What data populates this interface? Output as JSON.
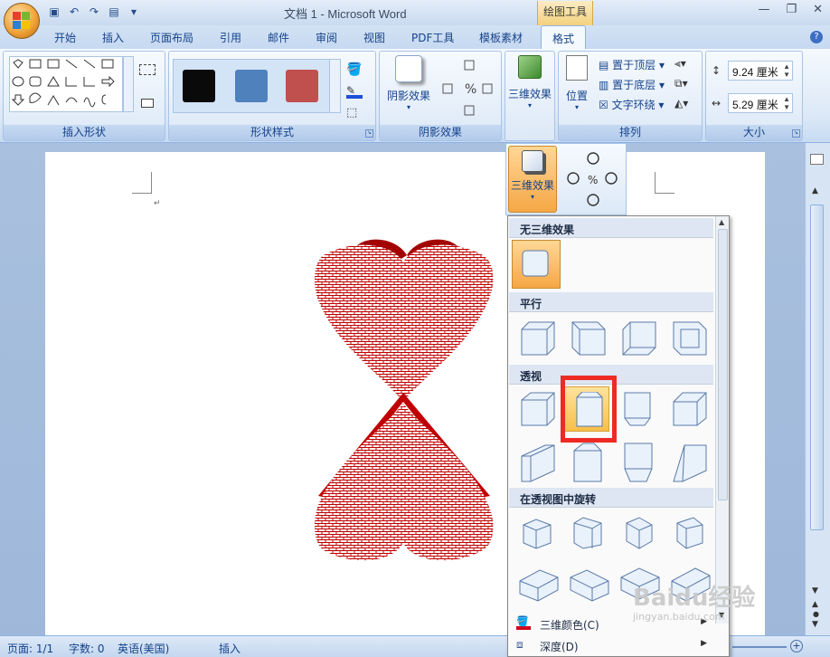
{
  "window": {
    "title": "文档 1 - Microsoft Word",
    "context_tab_header": "绘图工具"
  },
  "tabs": [
    {
      "label": "开始"
    },
    {
      "label": "插入"
    },
    {
      "label": "页面布局"
    },
    {
      "label": "引用"
    },
    {
      "label": "邮件"
    },
    {
      "label": "审阅"
    },
    {
      "label": "视图"
    },
    {
      "label": "PDF工具"
    },
    {
      "label": "模板素材"
    },
    {
      "label": "格式"
    }
  ],
  "active_tab": "格式",
  "ribbon": {
    "groups": {
      "insert_shapes": "插入形状",
      "shape_styles": "形状样式",
      "shadow_effects": "阴影效果",
      "effects_3d": "三维效果",
      "arrange": "排列",
      "size": "大小"
    },
    "shadow_button": "阴影效果",
    "effects_3d_button": "三维效果",
    "position_button": "位置",
    "bring_to_front": "置于顶层",
    "send_to_back": "置于底层",
    "text_wrap": "文字环绕",
    "height_value": "9.24 厘米",
    "width_value": "5.29 厘米",
    "swatch_colors": [
      "#0a0a0a",
      "#4f81bd",
      "#c0504d"
    ]
  },
  "dropdown_3d": {
    "button_label": "三维效果"
  },
  "gallery": {
    "sections": {
      "none": "无三维效果",
      "parallel": "平行",
      "perspective": "透视",
      "perspective_rotation": "在透视图中旋转"
    },
    "commands": {
      "color": "三维颜色(C)",
      "depth": "深度(D)"
    }
  },
  "statusbar": {
    "page": "页面: 1/1",
    "words": "字数: 0",
    "language": "英语(美国)",
    "mode": "插入"
  },
  "watermark": {
    "brand": "Baidu经验",
    "url": "jingyan.baidu.com"
  },
  "colors": {
    "heart_red": "#c00000",
    "highlight": "#f5a746",
    "selection_box": "#ee2a24"
  }
}
